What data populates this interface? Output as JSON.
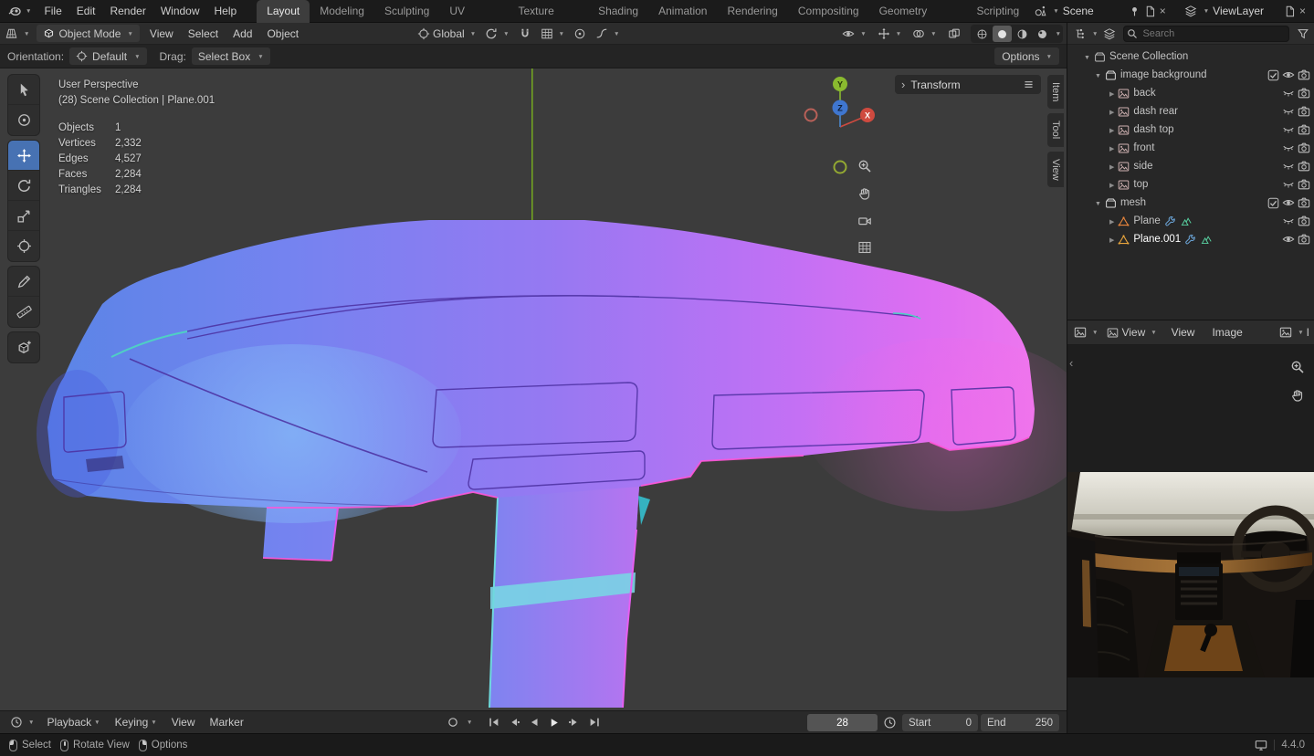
{
  "topbar": {
    "menus": [
      "File",
      "Edit",
      "Render",
      "Window",
      "Help"
    ],
    "workspaces": [
      "Layout",
      "Modeling",
      "Sculpting",
      "UV Editing",
      "Texture Paint",
      "Shading",
      "Animation",
      "Rendering",
      "Compositing",
      "Geometry Nodes",
      "Scripting"
    ],
    "scene": "Scene",
    "viewlayer": "ViewLayer"
  },
  "view3d": {
    "mode": "Object Mode",
    "menus": [
      "View",
      "Select",
      "Add",
      "Object"
    ],
    "orientation": "Global"
  },
  "tool_settings": {
    "orientation_label": "Orientation:",
    "orientation_value": "Default",
    "drag_label": "Drag:",
    "drag_value": "Select Box",
    "options": "Options"
  },
  "viewport": {
    "view_label": "User Perspective",
    "context": "(28) Scene Collection | Plane.001",
    "stats": [
      {
        "label": "Objects",
        "value": "1"
      },
      {
        "label": "Vertices",
        "value": "2,332"
      },
      {
        "label": "Edges",
        "value": "4,527"
      },
      {
        "label": "Faces",
        "value": "2,284"
      },
      {
        "label": "Triangles",
        "value": "2,284"
      }
    ],
    "gizmo": {
      "x": "X",
      "y": "Y",
      "z": "Z"
    },
    "transform_label": "Transform",
    "tabs": [
      "Item",
      "Tool",
      "View"
    ]
  },
  "outliner": {
    "search_placeholder": "Search",
    "rows": [
      {
        "name": "Scene Collection"
      },
      {
        "name": "image background"
      },
      {
        "name": "back"
      },
      {
        "name": "dash rear"
      },
      {
        "name": "dash top"
      },
      {
        "name": "front"
      },
      {
        "name": "side"
      },
      {
        "name": "top"
      },
      {
        "name": "mesh"
      },
      {
        "name": "Plane"
      },
      {
        "name": "Plane.001"
      }
    ]
  },
  "image_editor": {
    "mode": "View",
    "menus": [
      "View",
      "Image"
    ],
    "image_label": "I"
  },
  "timeline": {
    "menus": [
      "Playback",
      "Keying",
      "View",
      "Marker"
    ],
    "frame": "28",
    "start_label": "Start",
    "start_value": "0",
    "end_label": "End",
    "end_value": "250"
  },
  "status_bar": {
    "hints": [
      "Select",
      "Rotate View",
      "Options"
    ],
    "version": "4.4.0"
  },
  "colors": {
    "accent": "#4772b3"
  }
}
